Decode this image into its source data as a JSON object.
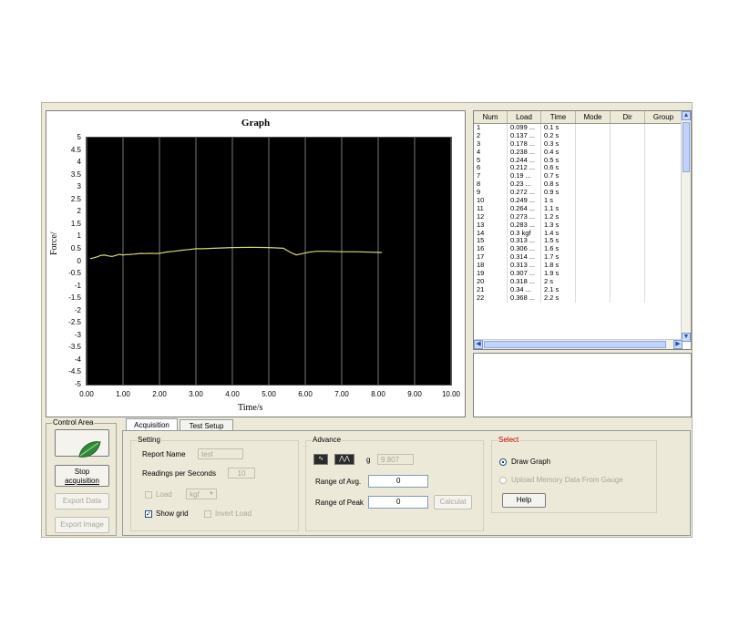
{
  "graph": {
    "title": "Graph",
    "xlabel": "Time/s",
    "ylabel": "Force/",
    "chart_data": {
      "type": "line",
      "title": "Graph",
      "xlabel": "Time/s",
      "ylabel": "Force/",
      "xlim": [
        0,
        10
      ],
      "ylim": [
        -5,
        5
      ],
      "grid": true,
      "x_ticks": [
        "0.00",
        "1.00",
        "2.00",
        "3.00",
        "4.00",
        "5.00",
        "6.00",
        "7.00",
        "8.00",
        "9.00",
        "10.00"
      ],
      "y_ticks": [
        "5",
        "4.5",
        "4",
        "3.5",
        "3",
        "2.5",
        "2",
        "1.5",
        "1",
        "0.5",
        "0",
        "-0.5",
        "-1",
        "-1.5",
        "-2",
        "-2.5",
        "-3",
        "-3.5",
        "-4",
        "-4.5",
        "-5"
      ],
      "series": [
        {
          "color": "#d8d878",
          "x": [
            0.1,
            0.2,
            0.3,
            0.4,
            0.5,
            0.6,
            0.7,
            0.8,
            0.9,
            1.0,
            1.1,
            1.2,
            1.3,
            1.4,
            1.5,
            1.6,
            1.7,
            1.8,
            1.9,
            2.0,
            2.1,
            2.2,
            2.4,
            2.6,
            2.8,
            3.0,
            3.2,
            3.5,
            4.0,
            4.5,
            5.0,
            5.4,
            5.6,
            5.75,
            5.9,
            6.1,
            6.3,
            6.6,
            7.0,
            7.4,
            7.8,
            8.1
          ],
          "y": [
            0.099,
            0.137,
            0.178,
            0.238,
            0.244,
            0.212,
            0.19,
            0.23,
            0.272,
            0.249,
            0.264,
            0.273,
            0.283,
            0.3,
            0.313,
            0.306,
            0.314,
            0.313,
            0.307,
            0.318,
            0.34,
            0.368,
            0.4,
            0.44,
            0.47,
            0.5,
            0.5,
            0.52,
            0.55,
            0.56,
            0.55,
            0.52,
            0.35,
            0.25,
            0.3,
            0.36,
            0.4,
            0.4,
            0.38,
            0.38,
            0.36,
            0.35
          ]
        }
      ]
    }
  },
  "table": {
    "columns": [
      "Num",
      "Load",
      "Time",
      "Mode",
      "Dir",
      "Group"
    ],
    "rows": [
      [
        "1",
        "0.099 ...",
        "0.1 s"
      ],
      [
        "2",
        "0.137 ...",
        "0.2 s"
      ],
      [
        "3",
        "0.178 ...",
        "0.3 s"
      ],
      [
        "4",
        "0.238 ...",
        "0.4 s"
      ],
      [
        "5",
        "0.244 ...",
        "0.5 s"
      ],
      [
        "6",
        "0.212 ...",
        "0.6 s"
      ],
      [
        "7",
        "0.19 ...",
        "0.7 s"
      ],
      [
        "8",
        "0.23 ...",
        "0.8 s"
      ],
      [
        "9",
        "0.272 ...",
        "0.9 s"
      ],
      [
        "10",
        "0.249 ...",
        "1 s"
      ],
      [
        "11",
        "0.264 ...",
        "1.1 s"
      ],
      [
        "12",
        "0.273 ...",
        "1.2 s"
      ],
      [
        "13",
        "0.283 ...",
        "1.3 s"
      ],
      [
        "14",
        "0.3 kgf",
        "1.4 s"
      ],
      [
        "15",
        "0.313 ...",
        "1.5 s"
      ],
      [
        "16",
        "0.306 ...",
        "1.6 s"
      ],
      [
        "17",
        "0.314 ...",
        "1.7 s"
      ],
      [
        "18",
        "0.313 ...",
        "1.8 s"
      ],
      [
        "19",
        "0.307 ...",
        "1.9 s"
      ],
      [
        "20",
        "0.318 ...",
        "2 s"
      ],
      [
        "21",
        "0.34 ...",
        "2.1 s"
      ],
      [
        "22",
        "0.368 ...",
        "2.2 s"
      ]
    ]
  },
  "control_area": {
    "legend": "Control Area",
    "stop_label_1": "Stop",
    "stop_label_2": "acquisition",
    "export_data": "Export Data",
    "export_image": "Export Image"
  },
  "tabs": [
    "Acquisition",
    "Test Setup"
  ],
  "setting": {
    "legend": "Setting",
    "report_name_label": "Report Name",
    "report_name_value": "test",
    "readings_label": "Readings per Seconds",
    "readings_value": "10",
    "load_label": "Load",
    "load_unit": "kgf",
    "show_grid_label": "Show grid",
    "invert_load_label": "Invert Load"
  },
  "advance": {
    "legend": "Advance",
    "g_label": "g",
    "g_value": "9.807",
    "range_avg_label": "Range of Avg.",
    "range_avg_value": "0",
    "range_peak_label": "Range of Peak",
    "range_peak_value": "0",
    "calculate": "Calculat"
  },
  "select": {
    "legend": "Select",
    "draw_graph": "Draw Graph",
    "upload": "Upload Memory Data From Gauge",
    "help": "Help"
  },
  "colors": {
    "plot_bg": "#000000",
    "grid": "#c8c8c8",
    "trace": "#d8d878",
    "accent": "#c00000"
  }
}
